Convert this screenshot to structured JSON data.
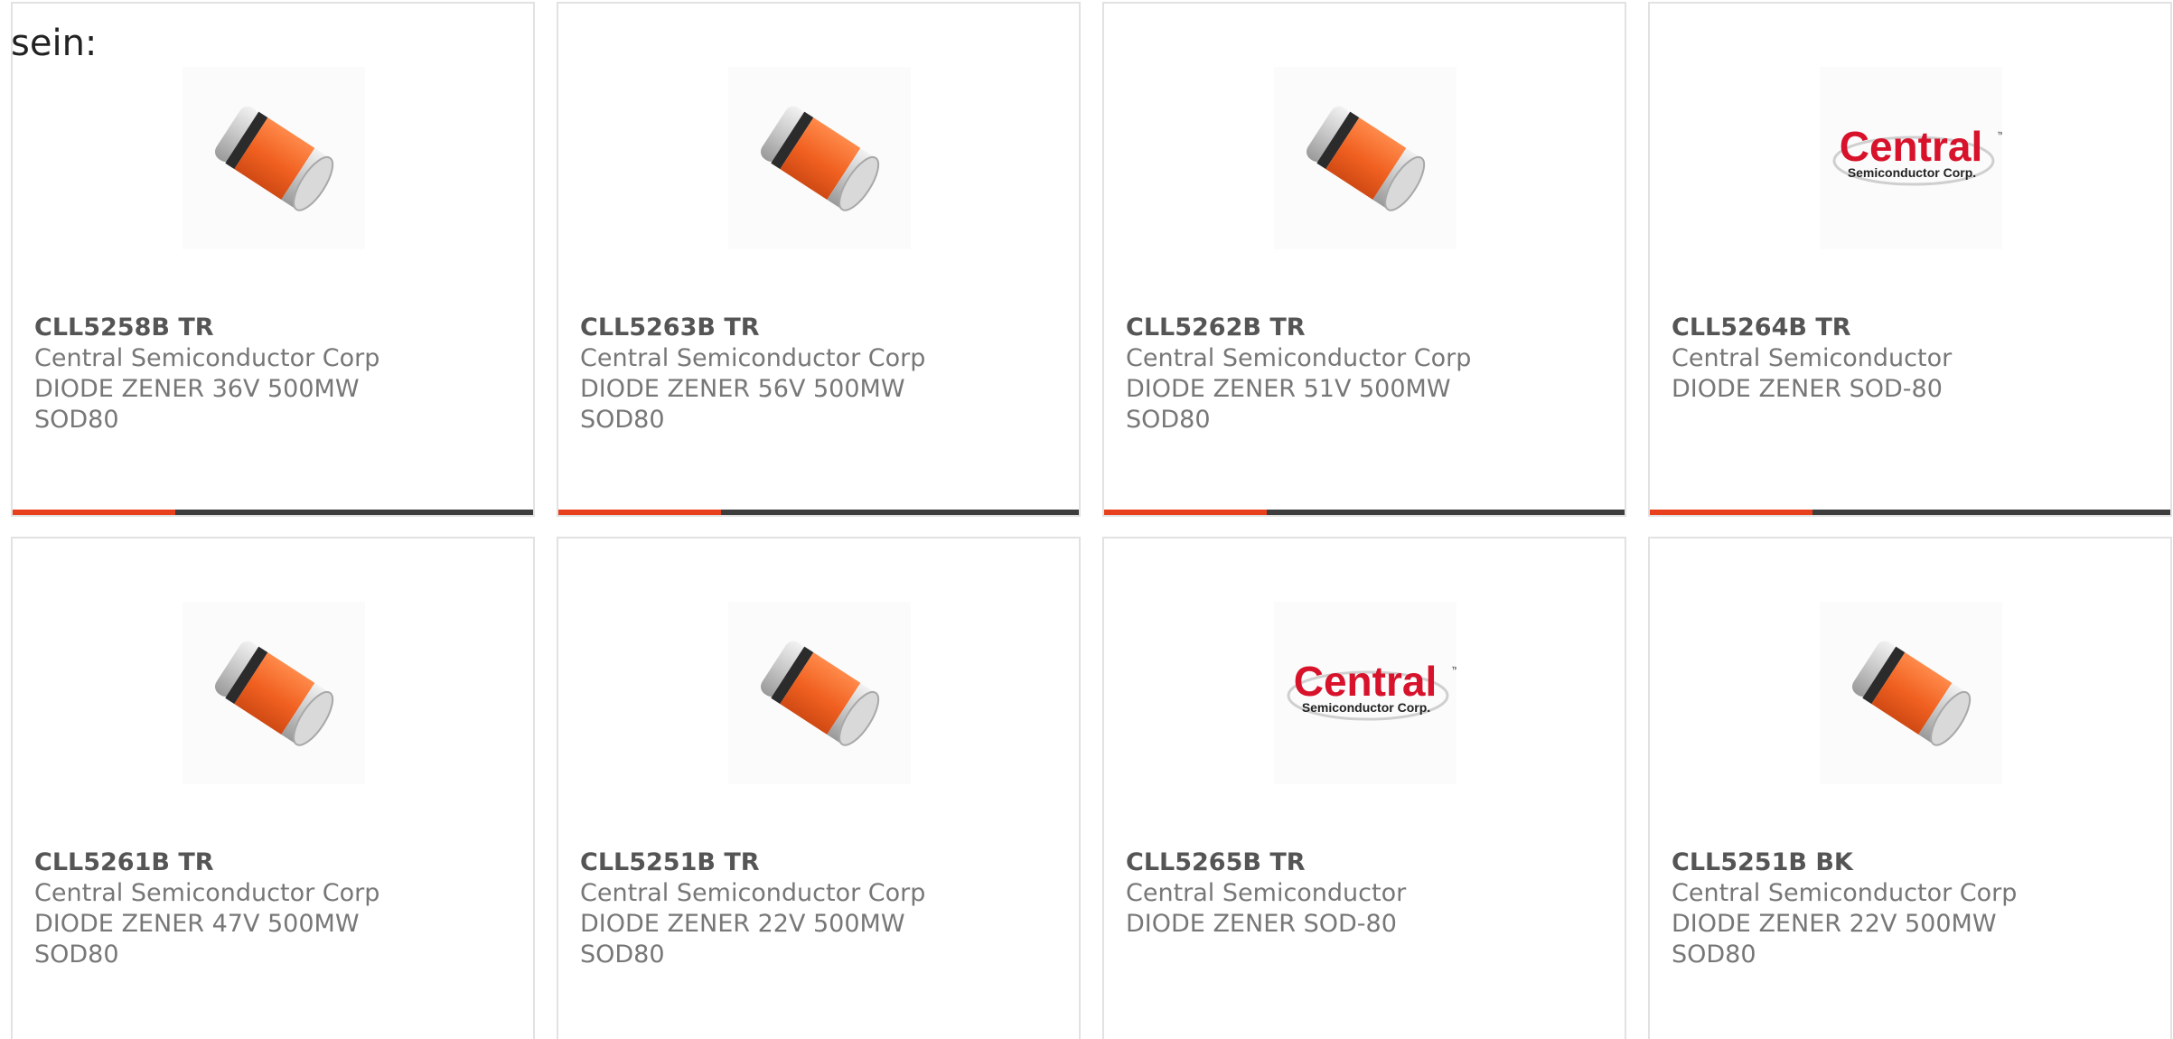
{
  "heading": "sein:",
  "colors": {
    "accent": "#e8401c",
    "bar": "#3d3d3d",
    "brand_red": "#d7122a"
  },
  "products": [
    {
      "part": "CLL5258B TR",
      "maker": "Central Semiconductor Corp",
      "desc": "DIODE ZENER 36V 500MW SOD80",
      "image": "zener-diode-image",
      "show_bar": true
    },
    {
      "part": "CLL5263B TR",
      "maker": "Central Semiconductor Corp",
      "desc": "DIODE ZENER 56V 500MW SOD80",
      "image": "zener-diode-image",
      "show_bar": true
    },
    {
      "part": "CLL5262B TR",
      "maker": "Central Semiconductor Corp",
      "desc": "DIODE ZENER 51V 500MW SOD80",
      "image": "zener-diode-image",
      "show_bar": true
    },
    {
      "part": "CLL5264B TR",
      "maker": "Central Semiconductor",
      "desc": "DIODE ZENER SOD-80",
      "image": "central-logo",
      "logo_main": "Central",
      "logo_sub": "Semiconductor Corp.",
      "show_bar": true
    },
    {
      "part": "CLL5261B TR",
      "maker": "Central Semiconductor Corp",
      "desc": "DIODE ZENER 47V 500MW SOD80",
      "image": "zener-diode-image",
      "show_bar": false
    },
    {
      "part": "CLL5251B TR",
      "maker": "Central Semiconductor Corp",
      "desc": "DIODE ZENER 22V 500MW SOD80",
      "image": "zener-diode-image",
      "show_bar": false
    },
    {
      "part": "CLL5265B TR",
      "maker": "Central Semiconductor",
      "desc": "DIODE ZENER SOD-80",
      "image": "central-logo",
      "logo_main": "Central",
      "logo_sub": "Semiconductor Corp.",
      "show_bar": false
    },
    {
      "part": "CLL5251B BK",
      "maker": "Central Semiconductor Corp",
      "desc": "DIODE ZENER 22V 500MW SOD80",
      "image": "zener-diode-image",
      "show_bar": false
    }
  ]
}
